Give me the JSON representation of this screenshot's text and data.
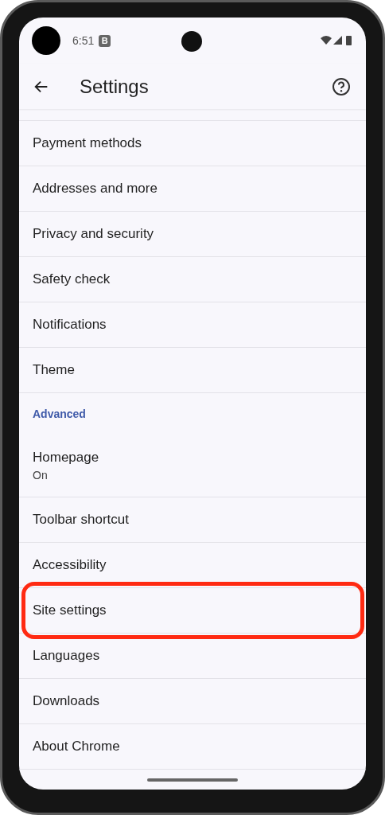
{
  "status_bar": {
    "time": "6:51",
    "badge": "B"
  },
  "app_bar": {
    "title": "Settings"
  },
  "items": [
    {
      "kind": "item",
      "label": "Payment methods",
      "highlighted": false
    },
    {
      "kind": "item",
      "label": "Addresses and more",
      "highlighted": false
    },
    {
      "kind": "item",
      "label": "Privacy and security",
      "highlighted": false
    },
    {
      "kind": "item",
      "label": "Safety check",
      "highlighted": false
    },
    {
      "kind": "item",
      "label": "Notifications",
      "highlighted": false
    },
    {
      "kind": "item",
      "label": "Theme",
      "highlighted": false
    },
    {
      "kind": "header",
      "label": "Advanced"
    },
    {
      "kind": "item",
      "label": "Homepage",
      "summary": "On",
      "highlighted": false
    },
    {
      "kind": "item",
      "label": "Toolbar shortcut",
      "highlighted": false
    },
    {
      "kind": "item",
      "label": "Accessibility",
      "highlighted": false
    },
    {
      "kind": "item",
      "label": "Site settings",
      "highlighted": true
    },
    {
      "kind": "item",
      "label": "Languages",
      "highlighted": false
    },
    {
      "kind": "item",
      "label": "Downloads",
      "highlighted": false
    },
    {
      "kind": "item",
      "label": "About Chrome",
      "highlighted": false
    }
  ]
}
